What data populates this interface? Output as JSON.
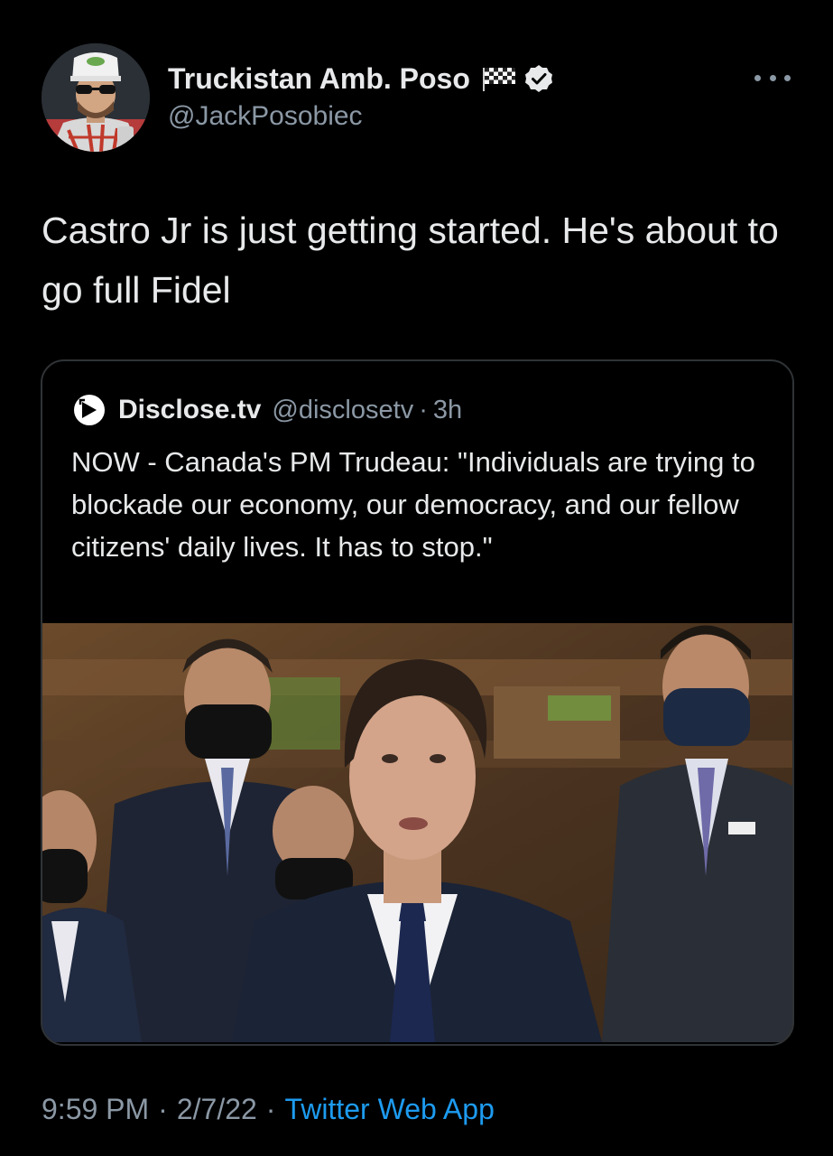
{
  "author": {
    "display_name": "Truckistan Amb. Poso",
    "handle": "@JackPosobiec",
    "flag_icon": "checkered-flag-icon",
    "verified_icon": "verified-badge-icon"
  },
  "tweet": {
    "text": "Castro Jr is just getting started. He's about to go full Fidel"
  },
  "quoted_tweet": {
    "display_name": "Disclose.tv",
    "handle": "@disclosetv",
    "separator": "·",
    "time_ago": "3h",
    "logo_icon": "disclose-tv-logo-icon",
    "text": "NOW - Canada's PM Trudeau: \"Individuals are trying to blockade our economy, our democracy, and our fellow citizens' daily lives. It has to stop.\""
  },
  "footer": {
    "time": "9:59 PM",
    "separator": "·",
    "date": "2/7/22",
    "app": "Twitter Web App"
  },
  "colors": {
    "background": "#000000",
    "text_primary": "#e7e9ea",
    "text_secondary": "#8b98a5",
    "link": "#1d9bf0",
    "border": "#2f3336"
  }
}
